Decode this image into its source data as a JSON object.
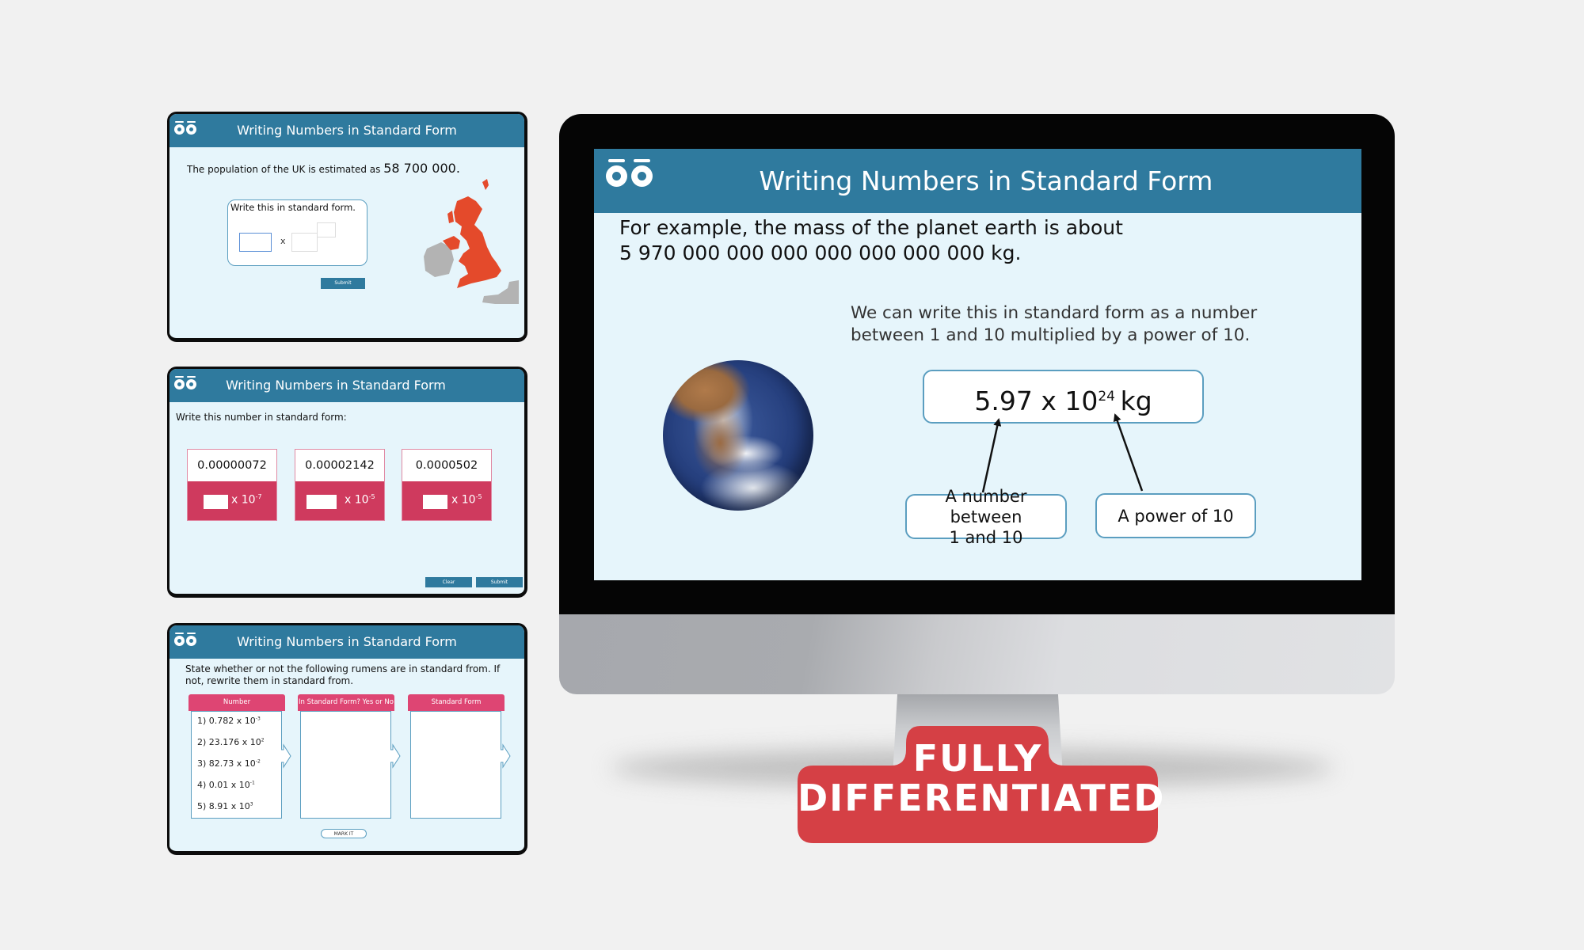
{
  "colors": {
    "header": "#2f7a9e",
    "slide_bg": "#e6f5fb",
    "pink": "#cf3a5e",
    "table_header": "#de4573",
    "badge": "#d54045",
    "uk_red": "#e44a2b",
    "uk_grey": "#b3b3b3"
  },
  "cards": [
    {
      "title": "Writing Numbers in Standard Form",
      "prompt_prefix": "The population of the UK is estimated as ",
      "prompt_number": "58 700 000.",
      "box_label": "Write this in standard form.",
      "times_symbol": "x",
      "coefficient_value": "",
      "base_value": "",
      "exponent_value": "",
      "submit_label": "Submit",
      "map_icon": "uk-map"
    },
    {
      "title": "Writing Numbers in Standard Form",
      "prompt": "Write this number in standard form:",
      "questions": [
        {
          "number": "0.00000072",
          "times": "x 10",
          "exponent": "-7",
          "answer": ""
        },
        {
          "number": "0.00002142",
          "times": "x 10",
          "exponent": "-5",
          "answer": ""
        },
        {
          "number": "0.0000502",
          "times": "x 10",
          "exponent": "-5",
          "answer": ""
        }
      ],
      "clear_label": "Clear",
      "submit_label": "Submit"
    },
    {
      "title": "Writing Numbers in Standard Form",
      "prompt": "State whether or not the following rumens are in standard from. If not, rewrite them  in standard from.",
      "columns": [
        "Number",
        "In Standard Form? Yes or No",
        "Standard Form"
      ],
      "rows": [
        {
          "index": "1)",
          "mantissa": "0.782 x 10",
          "exponent": "-3"
        },
        {
          "index": "2)",
          "mantissa": "23.176 x 10",
          "exponent": "2"
        },
        {
          "index": "3)",
          "mantissa": "82.73 x 10",
          "exponent": "-2"
        },
        {
          "index": "4)",
          "mantissa": "0.01 x 10",
          "exponent": "-1"
        },
        {
          "index": "5)",
          "mantissa": "8.91 x 10",
          "exponent": "3"
        }
      ],
      "mark_label": "MARK IT"
    }
  ],
  "main_slide": {
    "title": "Writing Numbers in Standard Form",
    "intro_line1": "For example, the mass of the planet earth is about",
    "intro_line2": "5 970 000 000 000 000 000 000 000 kg.",
    "explain_line1": "We can write this in standard form as a number",
    "explain_line2": "between 1 and 10 multiplied by a power of 10.",
    "standard_form_mantissa": "5.97 x 10",
    "standard_form_exponent": "24",
    "standard_form_unit": "kg",
    "callout_left_line1": "A number between",
    "callout_left_line2": "1 and 10",
    "callout_right": "A power of 10",
    "image_icon": "earth-globe"
  },
  "badge": {
    "line1": "FULLY",
    "line2": "DIFFERENTIATED"
  }
}
